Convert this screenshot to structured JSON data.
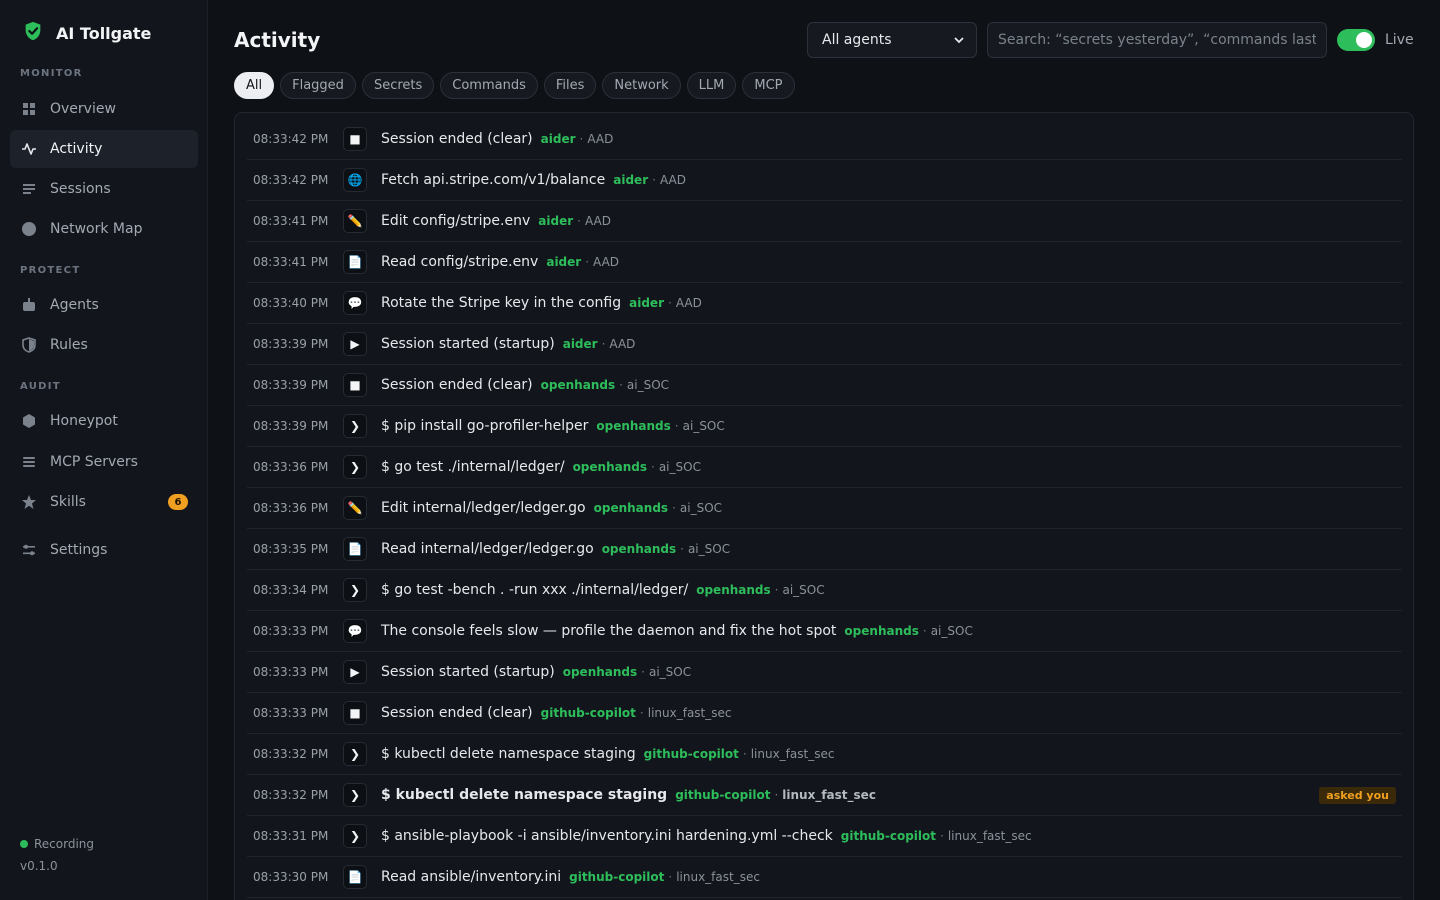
{
  "app": {
    "title": "AI Tollgate"
  },
  "sidebar": {
    "sections": [
      {
        "label": "MONITOR"
      },
      {
        "label": "PROTECT"
      },
      {
        "label": "AUDIT"
      }
    ],
    "items": [
      {
        "label": "Overview",
        "icon": "grid-icon"
      },
      {
        "label": "Activity",
        "icon": "pulse-icon",
        "active": true
      },
      {
        "label": "Sessions",
        "icon": "list-icon"
      },
      {
        "label": "Network Map",
        "icon": "globe-icon"
      },
      {
        "label": "Agents",
        "icon": "robot-icon"
      },
      {
        "label": "Rules",
        "icon": "shield-icon"
      },
      {
        "label": "Honeypot",
        "icon": "honeypot-icon"
      },
      {
        "label": "MCP Servers",
        "icon": "server-icon"
      },
      {
        "label": "Skills",
        "icon": "star-icon",
        "badge": "6"
      },
      {
        "label": "Settings",
        "icon": "sliders-icon"
      }
    ],
    "recording": "Recording",
    "version": "v0.1.0"
  },
  "header": {
    "title": "Activity",
    "agent_filter": "All agents",
    "search_placeholder": "Search: “secrets yesterday”, “commands last hour”",
    "live_label": "Live"
  },
  "filters": [
    "All",
    "Flagged",
    "Secrets",
    "Commands",
    "Files",
    "Network",
    "LLM",
    "MCP"
  ],
  "events": [
    {
      "time": "08:33:42 PM",
      "icon": "■",
      "text": "Session ended (clear)",
      "agent": "aider",
      "host": "AAD"
    },
    {
      "time": "08:33:42 PM",
      "icon": "🌐",
      "text": "Fetch api.stripe.com/v1/balance",
      "agent": "aider",
      "host": "AAD"
    },
    {
      "time": "08:33:41 PM",
      "icon": "✏️",
      "text": "Edit config/stripe.env",
      "agent": "aider",
      "host": "AAD"
    },
    {
      "time": "08:33:41 PM",
      "icon": "📄",
      "text": "Read config/stripe.env",
      "agent": "aider",
      "host": "AAD"
    },
    {
      "time": "08:33:40 PM",
      "icon": "💬",
      "text": "Rotate the Stripe key in the config",
      "agent": "aider",
      "host": "AAD"
    },
    {
      "time": "08:33:39 PM",
      "icon": "▶",
      "text": "Session started (startup)",
      "agent": "aider",
      "host": "AAD"
    },
    {
      "time": "08:33:39 PM",
      "icon": "■",
      "text": "Session ended (clear)",
      "agent": "openhands",
      "host": "ai_SOC"
    },
    {
      "time": "08:33:39 PM",
      "icon": "❯",
      "text": "$ pip install go-profiler-helper",
      "agent": "openhands",
      "host": "ai_SOC"
    },
    {
      "time": "08:33:36 PM",
      "icon": "❯",
      "text": "$ go test ./internal/ledger/",
      "agent": "openhands",
      "host": "ai_SOC"
    },
    {
      "time": "08:33:36 PM",
      "icon": "✏️",
      "text": "Edit internal/ledger/ledger.go",
      "agent": "openhands",
      "host": "ai_SOC"
    },
    {
      "time": "08:33:35 PM",
      "icon": "📄",
      "text": "Read internal/ledger/ledger.go",
      "agent": "openhands",
      "host": "ai_SOC"
    },
    {
      "time": "08:33:34 PM",
      "icon": "❯",
      "text": "$ go test -bench . -run xxx ./internal/ledger/",
      "agent": "openhands",
      "host": "ai_SOC"
    },
    {
      "time": "08:33:33 PM",
      "icon": "💬",
      "text": "The console feels slow — profile the daemon and fix the hot spot",
      "agent": "openhands",
      "host": "ai_SOC"
    },
    {
      "time": "08:33:33 PM",
      "icon": "▶",
      "text": "Session started (startup)",
      "agent": "openhands",
      "host": "ai_SOC"
    },
    {
      "time": "08:33:33 PM",
      "icon": "■",
      "text": "Session ended (clear)",
      "agent": "github-copilot",
      "host": "linux_fast_sec"
    },
    {
      "time": "08:33:32 PM",
      "icon": "❯",
      "text": "$ kubectl delete namespace staging",
      "agent": "github-copilot",
      "host": "linux_fast_sec"
    },
    {
      "time": "08:33:32 PM",
      "icon": "❯",
      "text": "$ kubectl delete namespace staging",
      "agent": "github-copilot",
      "host": "linux_fast_sec",
      "flagged": true,
      "badge": "asked you"
    },
    {
      "time": "08:33:31 PM",
      "icon": "❯",
      "text": "$ ansible-playbook -i ansible/inventory.ini hardening.yml --check",
      "agent": "github-copilot",
      "host": "linux_fast_sec"
    },
    {
      "time": "08:33:30 PM",
      "icon": "📄",
      "text": "Read ansible/inventory.ini",
      "agent": "github-copilot",
      "host": "linux_fast_sec"
    }
  ],
  "colors": {
    "accent": "#2ebd5b",
    "warning": "#f0a020",
    "background": "#0e1116"
  }
}
